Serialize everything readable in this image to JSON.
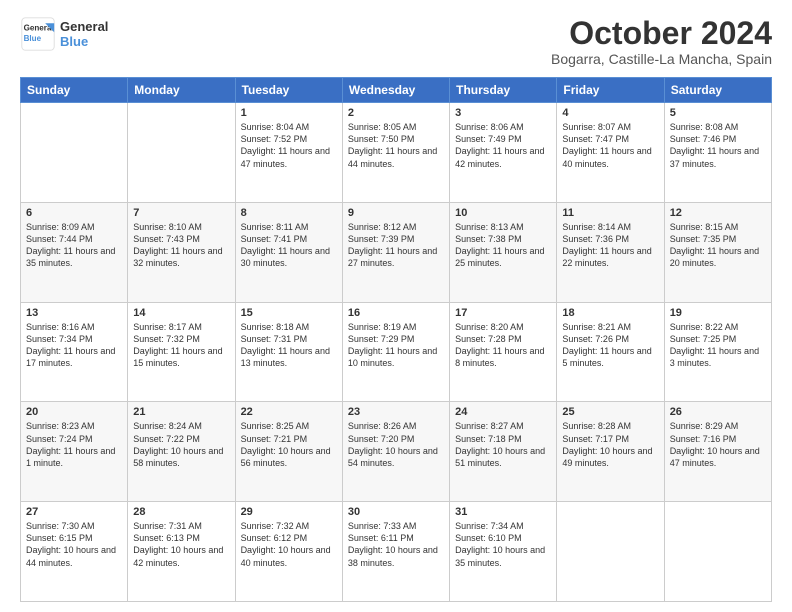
{
  "logo": {
    "line1": "General",
    "line2": "Blue"
  },
  "title": "October 2024",
  "location": "Bogarra, Castille-La Mancha, Spain",
  "days_of_week": [
    "Sunday",
    "Monday",
    "Tuesday",
    "Wednesday",
    "Thursday",
    "Friday",
    "Saturday"
  ],
  "weeks": [
    [
      {
        "day": "",
        "info": ""
      },
      {
        "day": "",
        "info": ""
      },
      {
        "day": "1",
        "info": "Sunrise: 8:04 AM\nSunset: 7:52 PM\nDaylight: 11 hours and 47 minutes."
      },
      {
        "day": "2",
        "info": "Sunrise: 8:05 AM\nSunset: 7:50 PM\nDaylight: 11 hours and 44 minutes."
      },
      {
        "day": "3",
        "info": "Sunrise: 8:06 AM\nSunset: 7:49 PM\nDaylight: 11 hours and 42 minutes."
      },
      {
        "day": "4",
        "info": "Sunrise: 8:07 AM\nSunset: 7:47 PM\nDaylight: 11 hours and 40 minutes."
      },
      {
        "day": "5",
        "info": "Sunrise: 8:08 AM\nSunset: 7:46 PM\nDaylight: 11 hours and 37 minutes."
      }
    ],
    [
      {
        "day": "6",
        "info": "Sunrise: 8:09 AM\nSunset: 7:44 PM\nDaylight: 11 hours and 35 minutes."
      },
      {
        "day": "7",
        "info": "Sunrise: 8:10 AM\nSunset: 7:43 PM\nDaylight: 11 hours and 32 minutes."
      },
      {
        "day": "8",
        "info": "Sunrise: 8:11 AM\nSunset: 7:41 PM\nDaylight: 11 hours and 30 minutes."
      },
      {
        "day": "9",
        "info": "Sunrise: 8:12 AM\nSunset: 7:39 PM\nDaylight: 11 hours and 27 minutes."
      },
      {
        "day": "10",
        "info": "Sunrise: 8:13 AM\nSunset: 7:38 PM\nDaylight: 11 hours and 25 minutes."
      },
      {
        "day": "11",
        "info": "Sunrise: 8:14 AM\nSunset: 7:36 PM\nDaylight: 11 hours and 22 minutes."
      },
      {
        "day": "12",
        "info": "Sunrise: 8:15 AM\nSunset: 7:35 PM\nDaylight: 11 hours and 20 minutes."
      }
    ],
    [
      {
        "day": "13",
        "info": "Sunrise: 8:16 AM\nSunset: 7:34 PM\nDaylight: 11 hours and 17 minutes."
      },
      {
        "day": "14",
        "info": "Sunrise: 8:17 AM\nSunset: 7:32 PM\nDaylight: 11 hours and 15 minutes."
      },
      {
        "day": "15",
        "info": "Sunrise: 8:18 AM\nSunset: 7:31 PM\nDaylight: 11 hours and 13 minutes."
      },
      {
        "day": "16",
        "info": "Sunrise: 8:19 AM\nSunset: 7:29 PM\nDaylight: 11 hours and 10 minutes."
      },
      {
        "day": "17",
        "info": "Sunrise: 8:20 AM\nSunset: 7:28 PM\nDaylight: 11 hours and 8 minutes."
      },
      {
        "day": "18",
        "info": "Sunrise: 8:21 AM\nSunset: 7:26 PM\nDaylight: 11 hours and 5 minutes."
      },
      {
        "day": "19",
        "info": "Sunrise: 8:22 AM\nSunset: 7:25 PM\nDaylight: 11 hours and 3 minutes."
      }
    ],
    [
      {
        "day": "20",
        "info": "Sunrise: 8:23 AM\nSunset: 7:24 PM\nDaylight: 11 hours and 1 minute."
      },
      {
        "day": "21",
        "info": "Sunrise: 8:24 AM\nSunset: 7:22 PM\nDaylight: 10 hours and 58 minutes."
      },
      {
        "day": "22",
        "info": "Sunrise: 8:25 AM\nSunset: 7:21 PM\nDaylight: 10 hours and 56 minutes."
      },
      {
        "day": "23",
        "info": "Sunrise: 8:26 AM\nSunset: 7:20 PM\nDaylight: 10 hours and 54 minutes."
      },
      {
        "day": "24",
        "info": "Sunrise: 8:27 AM\nSunset: 7:18 PM\nDaylight: 10 hours and 51 minutes."
      },
      {
        "day": "25",
        "info": "Sunrise: 8:28 AM\nSunset: 7:17 PM\nDaylight: 10 hours and 49 minutes."
      },
      {
        "day": "26",
        "info": "Sunrise: 8:29 AM\nSunset: 7:16 PM\nDaylight: 10 hours and 47 minutes."
      }
    ],
    [
      {
        "day": "27",
        "info": "Sunrise: 7:30 AM\nSunset: 6:15 PM\nDaylight: 10 hours and 44 minutes."
      },
      {
        "day": "28",
        "info": "Sunrise: 7:31 AM\nSunset: 6:13 PM\nDaylight: 10 hours and 42 minutes."
      },
      {
        "day": "29",
        "info": "Sunrise: 7:32 AM\nSunset: 6:12 PM\nDaylight: 10 hours and 40 minutes."
      },
      {
        "day": "30",
        "info": "Sunrise: 7:33 AM\nSunset: 6:11 PM\nDaylight: 10 hours and 38 minutes."
      },
      {
        "day": "31",
        "info": "Sunrise: 7:34 AM\nSunset: 6:10 PM\nDaylight: 10 hours and 35 minutes."
      },
      {
        "day": "",
        "info": ""
      },
      {
        "day": "",
        "info": ""
      }
    ]
  ]
}
